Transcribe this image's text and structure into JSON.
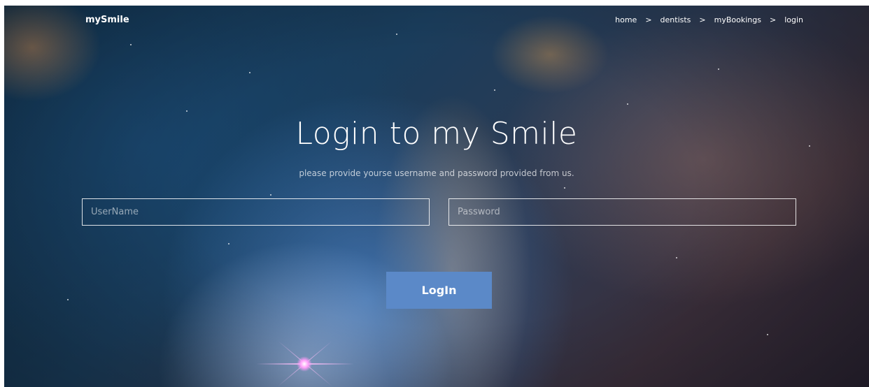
{
  "header": {
    "brand": "mySmile",
    "breadcrumb": [
      {
        "label": "home"
      },
      {
        "label": "dentists"
      },
      {
        "label": "myBookings"
      },
      {
        "label": "login"
      }
    ],
    "separator": ">"
  },
  "main": {
    "title": "Login to my Smile",
    "subtitle": "please provide yourse username and password provided from us.",
    "username": {
      "value": "",
      "placeholder": "UserName"
    },
    "password": {
      "value": "",
      "placeholder": "Password"
    },
    "login_label": "LogIn"
  },
  "colors": {
    "button": "#5b89c8",
    "text": "#ffffff"
  }
}
